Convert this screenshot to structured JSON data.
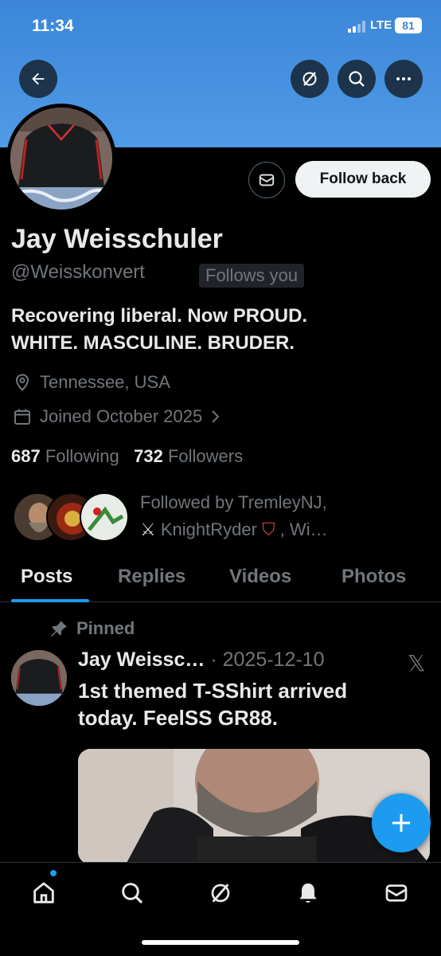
{
  "status_bar": {
    "time": "11:34",
    "network": "LTE",
    "battery": "81"
  },
  "header": {
    "back_icon": "arrow-left-icon",
    "grok_icon": "grok-icon",
    "search_icon": "search-icon",
    "more_icon": "more-horizontal-icon"
  },
  "profile": {
    "name": "Jay Weisschuler",
    "handle": "@Weisskonvert",
    "follows_you": "Follows you",
    "follow_back_label": "Follow back",
    "bio_line1": "Recovering liberal. Now PROUD.",
    "bio_line2": "WHITE. MASCULINE. BRUDER.",
    "location": "Tennessee, USA",
    "joined": "Joined October 2025",
    "following_count": "687",
    "following_label": "Following",
    "followers_count": "732",
    "followers_label": "Followers",
    "followed_by_line1": "Followed by TremleyNJ,",
    "followed_by_line2": "KnightRyder",
    "followed_by_line2_suffix": ", Wi…"
  },
  "tabs": [
    "Posts",
    "Replies",
    "Videos",
    "Photos"
  ],
  "active_tab": "Posts",
  "pinned_post": {
    "pinned_label": "Pinned",
    "author": "Jay Weissc…",
    "separator": "·",
    "date": "2025-12-10",
    "text_line1": "1st themed T-SShirt arrived",
    "text_line2": "today. FeelSS GR88."
  },
  "bottom_nav": [
    "home-icon",
    "search-icon",
    "grok-icon",
    "notifications-bell-icon",
    "messages-envelope-icon"
  ],
  "colors": {
    "banner": "#4a94e2",
    "accent": "#1d9bf0",
    "background": "#000000",
    "secondary_text": "#71767b"
  }
}
